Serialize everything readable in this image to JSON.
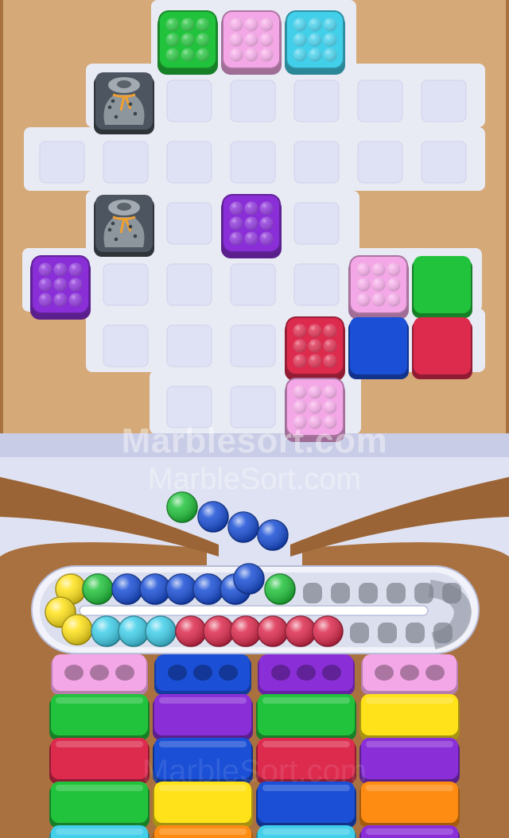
{
  "watermark": {
    "primary": "Marblesort.com",
    "secondary": "MarbleSort.com",
    "bottom": "MarbleSort.com"
  },
  "colors": {
    "green": "#22c33c",
    "pink": "#f4a7e6",
    "cyan": "#42cfea",
    "purple": "#8a2fd8",
    "red": "#dd2b4e",
    "blue": "#1a4fd6",
    "yellow": "#ffe21a",
    "orange": "#ff8c12",
    "gray": "#8d959d",
    "empty_cell": "#dfe2f4",
    "board": "#e8eaf4",
    "wall": "#d5a978"
  },
  "board": {
    "cols": 8,
    "rows": 7,
    "empty_cells": [
      [
        2,
        1
      ],
      [
        3,
        1
      ],
      [
        4,
        1
      ],
      [
        5,
        1
      ],
      [
        6,
        1
      ],
      [
        0,
        2
      ],
      [
        1,
        2
      ],
      [
        2,
        2
      ],
      [
        3,
        2
      ],
      [
        4,
        2
      ],
      [
        5,
        2
      ],
      [
        6,
        2
      ],
      [
        2,
        3
      ],
      [
        4,
        3
      ],
      [
        1,
        4
      ],
      [
        2,
        4
      ],
      [
        3,
        4
      ],
      [
        4,
        4
      ],
      [
        1,
        5
      ],
      [
        2,
        5
      ],
      [
        3,
        5
      ],
      [
        2,
        6
      ],
      [
        3,
        6
      ]
    ],
    "bubble_blocks": [
      {
        "color": "green",
        "col": 2,
        "row": 0
      },
      {
        "color": "pink",
        "col": 3,
        "row": 0
      },
      {
        "color": "cyan",
        "col": 4,
        "row": 0
      },
      {
        "color": "purple",
        "col": 3,
        "row": 3
      },
      {
        "color": "purple",
        "col": 0,
        "row": 4
      },
      {
        "color": "pink",
        "col": 5,
        "row": 4
      },
      {
        "color": "red",
        "col": 4,
        "row": 5
      },
      {
        "color": "pink",
        "col": 4,
        "row": 6
      }
    ],
    "solid_blocks": [
      {
        "color": "green",
        "col": 6,
        "row": 4
      },
      {
        "color": "blue",
        "col": 5,
        "row": 5
      },
      {
        "color": "red",
        "col": 6,
        "row": 5
      }
    ],
    "locked_sacks": [
      {
        "icon": "marble-sack-icon",
        "col": 1,
        "row": 1
      },
      {
        "icon": "marble-sack-icon",
        "col": 1,
        "row": 3
      }
    ]
  },
  "funnel_marbles": [
    "green",
    "blue",
    "blue",
    "blue"
  ],
  "track": {
    "top_row": [
      "yellow",
      "green",
      "blue",
      "blue",
      "blue",
      "blue",
      "blue",
      "blue",
      "green"
    ],
    "bottom_row": [
      "yellow",
      "yellow",
      "cyan",
      "cyan",
      "cyan",
      "red",
      "red",
      "red",
      "red",
      "red",
      "red"
    ],
    "top_empty_slots": 6,
    "bottom_empty_slots": 4
  },
  "containers": [
    {
      "top": "pink",
      "stack": [
        "green",
        "red",
        "green",
        "cyan"
      ]
    },
    {
      "top": "blue",
      "stack": [
        "purple",
        "blue",
        "yellow",
        "orange"
      ]
    },
    {
      "top": "purple",
      "stack": [
        "green",
        "red",
        "blue",
        "cyan"
      ]
    },
    {
      "top": "pink",
      "stack": [
        "yellow",
        "purple",
        "orange",
        "purple"
      ]
    }
  ]
}
